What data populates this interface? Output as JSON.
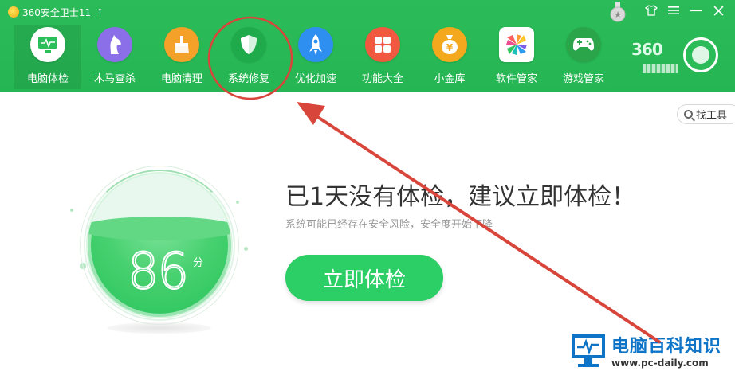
{
  "window": {
    "title": "360安全卫士11",
    "controls": [
      {
        "name": "skin-icon",
        "glyph": "👕"
      },
      {
        "name": "menu-icon",
        "glyph": "☰"
      },
      {
        "name": "minimize-icon",
        "glyph": "—"
      },
      {
        "name": "close-icon",
        "glyph": "✕"
      }
    ]
  },
  "nav": {
    "items": [
      {
        "label": "电脑体检",
        "icon": "monitor-icon",
        "color": "#2bbf5c",
        "active": true
      },
      {
        "label": "木马查杀",
        "icon": "horse-icon",
        "color": "#8b6fe8"
      },
      {
        "label": "电脑清理",
        "icon": "broom-icon",
        "color": "#f4a12a"
      },
      {
        "label": "系统修复",
        "icon": "shield-icon",
        "color": "#1faa4c"
      },
      {
        "label": "优化加速",
        "icon": "rocket-icon",
        "color": "#2f8ff0"
      },
      {
        "label": "功能大全",
        "icon": "grid-icon",
        "color": "#f0593f"
      },
      {
        "label": "小金库",
        "icon": "money-bag-icon",
        "color": "#f4a81d"
      },
      {
        "label": "软件管家",
        "icon": "flower-icon",
        "color": "#ffffff"
      },
      {
        "label": "游戏管家",
        "icon": "gamepad-icon",
        "color": "#2aa549"
      }
    ],
    "brand": "360"
  },
  "find_tool": {
    "label": "找工具"
  },
  "score": {
    "value": "86",
    "unit": "分"
  },
  "main": {
    "headline": "已1天没有体检，建议立即体检！",
    "subline": "系统可能已经存在安全风险，安全度开始下降",
    "button_label": "立即体检"
  },
  "watermark": {
    "title": "电脑百科知识",
    "url": "www.pc-daily.com"
  },
  "annotation_colors": {
    "highlight": "#d8453a"
  }
}
